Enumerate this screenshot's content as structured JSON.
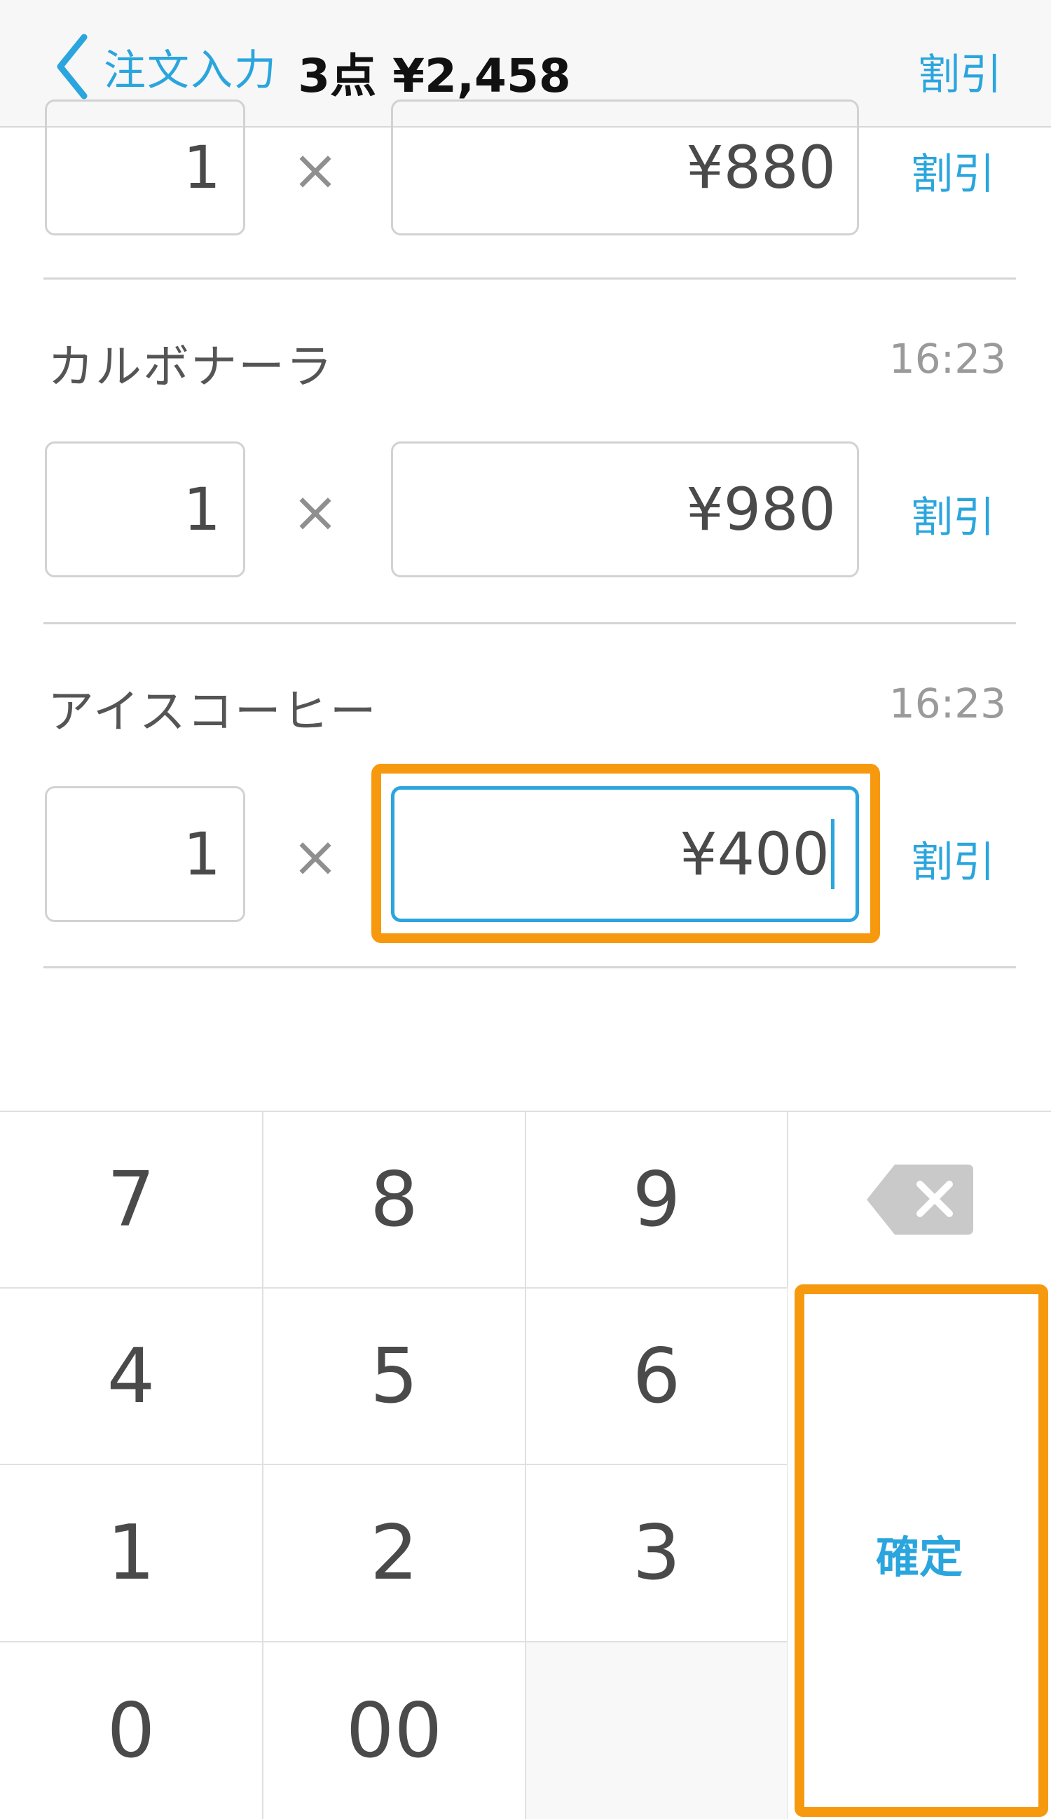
{
  "navbar": {
    "back_label": "注文入力",
    "title": "3点 ¥2,458",
    "discount_label": "割引"
  },
  "items": [
    {
      "name": "",
      "time": "",
      "quantity": "1",
      "times": "×",
      "price": "¥880",
      "discount_label": "割引"
    },
    {
      "name": "カルボナーラ",
      "time": "16:23",
      "quantity": "1",
      "times": "×",
      "price": "¥980",
      "discount_label": "割引"
    },
    {
      "name": "アイスコーヒー",
      "time": "16:23",
      "quantity": "1",
      "times": "×",
      "price": "¥400",
      "discount_label": "割引"
    }
  ],
  "keypad": {
    "keys": [
      "7",
      "8",
      "9",
      "4",
      "5",
      "6",
      "1",
      "2",
      "3",
      "0",
      "00"
    ],
    "confirm_label": "確定"
  },
  "colors": {
    "accent": "#2aa5de",
    "highlight": "#f7990f"
  }
}
